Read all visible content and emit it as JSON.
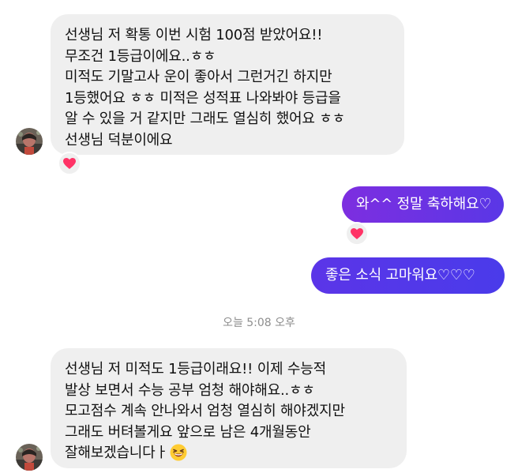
{
  "conversation": {
    "messages": [
      {
        "direction": "incoming",
        "lines": [
          "선생님 저 확통 이번 시험 100점 받았어요!!",
          "무조건 1등급이에요..ㅎㅎ",
          "미적도 기말고사 운이 좋아서 그런거긴 하지만",
          "1등했어요 ㅎㅎ 미적은 성적표 나와봐야 등급을",
          "알 수 있을 거 같지만 그래도 열심히 했어요 ㅎㅎ",
          "선생님 덕분이에요"
        ],
        "reaction": "heart-icon"
      },
      {
        "direction": "outgoing",
        "text": "와^^ 정말 축하해요♡",
        "reaction": "heart-icon"
      },
      {
        "direction": "outgoing",
        "text": "좋은 소식 고마워요♡♡♡"
      },
      {
        "direction": "incoming",
        "lines": [
          "선생님 저 미적도 1등급이래요!! 이제 수능적",
          "발상 보면서 수능 공부 엄청 해야해요..ㅎㅎ",
          "모고점수 계속 안나와서 엄청 열심히 해야겠지만",
          "그래도 버텨볼게요 앞으로 남은 4개월동안",
          "잘해보겠습니다ㅏ"
        ],
        "trailing_emoji": "grinning-squinting-face-emoji"
      }
    ],
    "timestamp": "오늘 5:08 오후"
  },
  "colors": {
    "incoming_bubble": "#efefef",
    "outgoing_gradient_start": "#7d2ee0",
    "outgoing_gradient_end": "#4a3bea",
    "heart": "#ff3366",
    "timestamp_text": "#8e8e8e"
  }
}
